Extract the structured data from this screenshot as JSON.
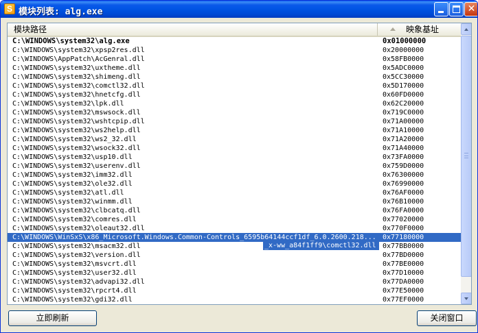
{
  "window": {
    "title": "模块列表: alg.exe",
    "icon_letter": "S",
    "close_glyph": "✕"
  },
  "list": {
    "headers": {
      "path": "模块路径",
      "base": "映象基址"
    },
    "sort_icon": "sort-ascending-icon",
    "rows": [
      {
        "path": "C:\\WINDOWS\\system32\\alg.exe",
        "base": "0x01000000",
        "bold": true
      },
      {
        "path": "C:\\WINDOWS\\system32\\xpsp2res.dll",
        "base": "0x20000000"
      },
      {
        "path": "C:\\WINDOWS\\AppPatch\\AcGenral.dll",
        "base": "0x58FB0000"
      },
      {
        "path": "C:\\WINDOWS\\system32\\uxtheme.dll",
        "base": "0x5ADC0000"
      },
      {
        "path": "C:\\WINDOWS\\system32\\shimeng.dll",
        "base": "0x5CC30000"
      },
      {
        "path": "C:\\WINDOWS\\system32\\comctl32.dll",
        "base": "0x5D170000"
      },
      {
        "path": "C:\\WINDOWS\\system32\\hnetcfg.dll",
        "base": "0x60FD0000"
      },
      {
        "path": "C:\\WINDOWS\\system32\\lpk.dll",
        "base": "0x62C20000"
      },
      {
        "path": "C:\\WINDOWS\\system32\\mswsock.dll",
        "base": "0x719C0000"
      },
      {
        "path": "C:\\WINDOWS\\system32\\wshtcpip.dll",
        "base": "0x71A00000"
      },
      {
        "path": "C:\\WINDOWS\\system32\\ws2help.dll",
        "base": "0x71A10000"
      },
      {
        "path": "C:\\WINDOWS\\system32\\ws2_32.dll",
        "base": "0x71A20000"
      },
      {
        "path": "C:\\WINDOWS\\system32\\wsock32.dll",
        "base": "0x71A40000"
      },
      {
        "path": "C:\\WINDOWS\\system32\\usp10.dll",
        "base": "0x73FA0000"
      },
      {
        "path": "C:\\WINDOWS\\system32\\userenv.dll",
        "base": "0x759D0000"
      },
      {
        "path": "C:\\WINDOWS\\system32\\imm32.dll",
        "base": "0x76300000"
      },
      {
        "path": "C:\\WINDOWS\\system32\\ole32.dll",
        "base": "0x76990000"
      },
      {
        "path": "C:\\WINDOWS\\system32\\atl.dll",
        "base": "0x76AF0000"
      },
      {
        "path": "C:\\WINDOWS\\system32\\winmm.dll",
        "base": "0x76B10000"
      },
      {
        "path": "C:\\WINDOWS\\system32\\clbcatq.dll",
        "base": "0x76FA0000"
      },
      {
        "path": "C:\\WINDOWS\\system32\\comres.dll",
        "base": "0x77020000"
      },
      {
        "path": "C:\\WINDOWS\\system32\\oleaut32.dll",
        "base": "0x770F0000"
      },
      {
        "path": "C:\\WINDOWS\\WinSxS\\x86_Microsoft.Windows.Common-Controls_6595b64144ccf1df_6.0.2600.218...",
        "base": "0x77180000",
        "selected": true
      },
      {
        "path": "C:\\WINDOWS\\system32\\msacm32.dll",
        "base": "0x77BB0000"
      },
      {
        "path": "C:\\WINDOWS\\system32\\version.dll",
        "base": "0x77BD0000"
      },
      {
        "path": "C:\\WINDOWS\\system32\\msvcrt.dll",
        "base": "0x77BE0000"
      },
      {
        "path": "C:\\WINDOWS\\system32\\user32.dll",
        "base": "0x77D10000"
      },
      {
        "path": "C:\\WINDOWS\\system32\\advapi32.dll",
        "base": "0x77DA0000"
      },
      {
        "path": "C:\\WINDOWS\\system32\\rpcrt4.dll",
        "base": "0x77E50000"
      },
      {
        "path": "C:\\WINDOWS\\system32\\gdi32.dll",
        "base": "0x77EF0000"
      }
    ],
    "tooltip": "_x-ww_a84f1ff9\\comctl32.dll"
  },
  "buttons": {
    "refresh": "立即刷新",
    "close": "关闭窗口"
  },
  "colors": {
    "selection": "#316ac5",
    "titlebar": "#0054e3",
    "window_bg": "#ece9d8"
  }
}
